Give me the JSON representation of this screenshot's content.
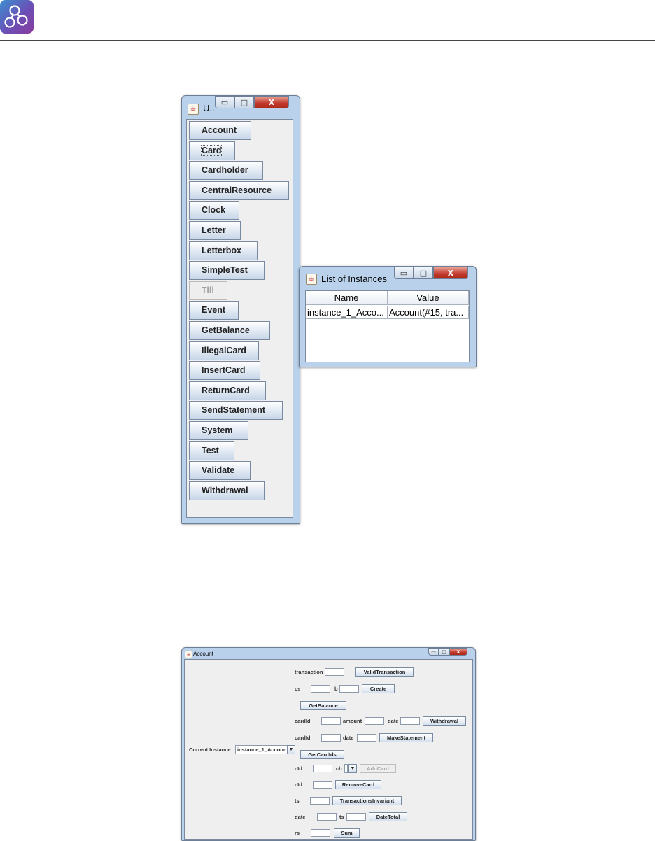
{
  "header": {
    "logo_icon": "circles-logo-icon"
  },
  "ui_window": {
    "title": "U..",
    "controls": {
      "minimize": "▭",
      "maximize": "□",
      "close": "X"
    },
    "buttons": [
      {
        "label": "Account",
        "enabled": true
      },
      {
        "label": "Card",
        "enabled": true,
        "focused": true
      },
      {
        "label": "Cardholder",
        "enabled": true
      },
      {
        "label": "CentralResource",
        "enabled": true
      },
      {
        "label": "Clock",
        "enabled": true
      },
      {
        "label": "Letter",
        "enabled": true
      },
      {
        "label": "Letterbox",
        "enabled": true
      },
      {
        "label": "SimpleTest",
        "enabled": true
      },
      {
        "label": "Till",
        "enabled": false
      },
      {
        "label": "Event",
        "enabled": true
      },
      {
        "label": "GetBalance",
        "enabled": true
      },
      {
        "label": "IllegalCard",
        "enabled": true
      },
      {
        "label": "InsertCard",
        "enabled": true
      },
      {
        "label": "ReturnCard",
        "enabled": true
      },
      {
        "label": "SendStatement",
        "enabled": true
      },
      {
        "label": "System",
        "enabled": true
      },
      {
        "label": "Test",
        "enabled": true
      },
      {
        "label": "Validate",
        "enabled": true
      },
      {
        "label": "Withdrawal",
        "enabled": true
      }
    ]
  },
  "instances_window": {
    "title": "List of Instances",
    "controls": {
      "minimize": "▭",
      "maximize": "□",
      "close": "X"
    },
    "columns": [
      "Name",
      "Value"
    ],
    "rows": [
      [
        "instance_1_Acco...",
        "Account(#15, tra..."
      ]
    ]
  },
  "account_window": {
    "title": "Account",
    "controls": {
      "minimize": "▭",
      "maximize": "□",
      "close": "x"
    },
    "current_instance_label": "Current Instance:",
    "current_instance_value": "instance_1_Account",
    "rows": {
      "valid_transaction": {
        "label": "transaction",
        "button": "ValidTransaction"
      },
      "create": {
        "label1": "cs",
        "label2": "b",
        "button": "Create"
      },
      "get_balance": {
        "button": "GetBalance"
      },
      "withdrawal": {
        "label1": "cardId",
        "label2": "amount",
        "label3": "date",
        "button": "Withdrawal"
      },
      "make_statement": {
        "label1": "cardId",
        "label2": "date",
        "button": "MakeStatement"
      },
      "get_card_ids": {
        "button": "GetCardIds"
      },
      "add_card": {
        "label1": "cId",
        "label2": "ch",
        "button": "AddCard"
      },
      "remove_card": {
        "label": "cId",
        "button": "RemoveCard"
      },
      "transactions_invariant": {
        "label": "ts",
        "button": "TransactionsInvariant"
      },
      "date_total": {
        "label1": "date",
        "label2": "ts",
        "button": "DateTotal"
      },
      "sum": {
        "label": "rs",
        "button": "Sum"
      }
    }
  }
}
